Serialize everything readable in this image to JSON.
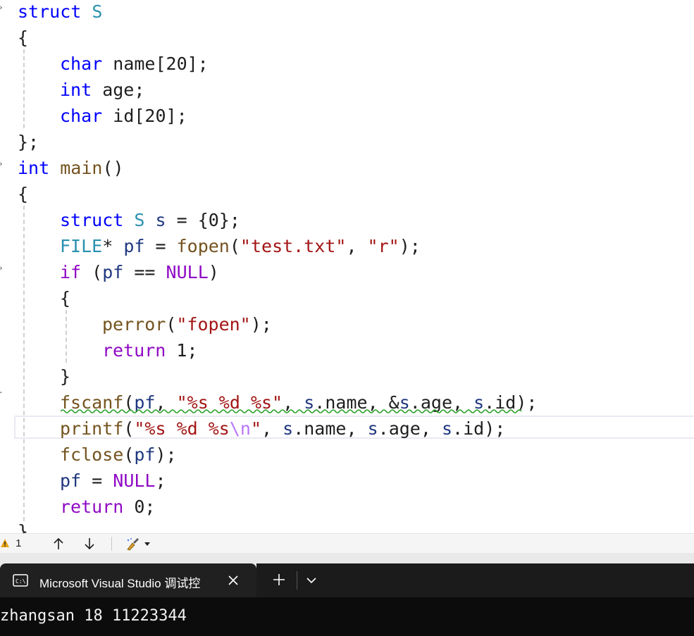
{
  "editor": {
    "lines": {
      "l1": {
        "t": [
          "struct",
          " ",
          "S"
        ]
      },
      "l2": {
        "t": [
          "{"
        ]
      },
      "l3": {
        "t": [
          "char",
          " name[20];"
        ]
      },
      "l4": {
        "t": [
          "int",
          " age;"
        ]
      },
      "l5": {
        "t": [
          "char",
          " id[20];"
        ]
      },
      "l6": {
        "t": [
          "};"
        ]
      },
      "l7": {
        "t": [
          "int",
          " ",
          "main",
          "()"
        ]
      },
      "l8": {
        "t": [
          "{"
        ]
      },
      "l9": {
        "t": [
          "struct",
          " ",
          "S",
          " ",
          "s",
          " = {0};"
        ]
      },
      "l10": {
        "t": [
          "FILE",
          "* ",
          "pf",
          " = ",
          "fopen",
          "(",
          "\"test.txt\"",
          ", ",
          "\"r\"",
          ");"
        ]
      },
      "l11": {
        "t": [
          "if",
          " (",
          "pf",
          " == ",
          "NULL",
          ")"
        ]
      },
      "l12": {
        "t": [
          "{"
        ]
      },
      "l13": {
        "t": [
          "perror",
          "(",
          "\"fopen\"",
          ");"
        ]
      },
      "l14": {
        "t": [
          "return",
          " 1;"
        ]
      },
      "l15": {
        "t": [
          "}"
        ]
      },
      "l16": {
        "t": [
          "fscanf",
          "(",
          "pf",
          ", ",
          "\"%s %d %s\"",
          ", ",
          "s",
          ".",
          "name",
          ", &",
          "s",
          ".",
          "age",
          ", ",
          "s",
          ".",
          "id",
          ");"
        ]
      },
      "l17": {
        "t": [
          "printf",
          "(",
          "\"%s %d %s",
          "\\n",
          "\"",
          ", ",
          "s",
          ".",
          "name",
          ", ",
          "s",
          ".",
          "age",
          ", ",
          "s",
          ".",
          "id",
          ");"
        ]
      },
      "l18": {
        "t": [
          "fclose",
          "(",
          "pf",
          ");"
        ]
      },
      "l19": {
        "t": [
          "pf",
          " = ",
          "NULL",
          ";"
        ]
      },
      "l20": {
        "t": [
          "return",
          " 0;"
        ]
      },
      "l21": {
        "t": [
          "}"
        ]
      }
    }
  },
  "status_bar": {
    "warning_count": "1",
    "icons": {
      "warning": "warning-icon",
      "up": "arrow-up-icon",
      "down": "arrow-down-icon",
      "cleanup": "brush-icon"
    }
  },
  "console": {
    "tab_title": "Microsoft Visual Studio 调试控",
    "icons": {
      "terminal": "terminal-icon",
      "close": "close-icon",
      "new_tab": "plus-icon",
      "dropdown": "chevron-down-icon"
    },
    "output": "zhangsan 18 11223344"
  },
  "colors": {
    "keyword": "#0000ff",
    "type": "#2b91af",
    "function": "#74531f",
    "string": "#a31515",
    "macro": "#8f08c4",
    "variable": "#1f377f",
    "squiggle": "#2ba12b",
    "console_bg": "#0c0c0c"
  }
}
